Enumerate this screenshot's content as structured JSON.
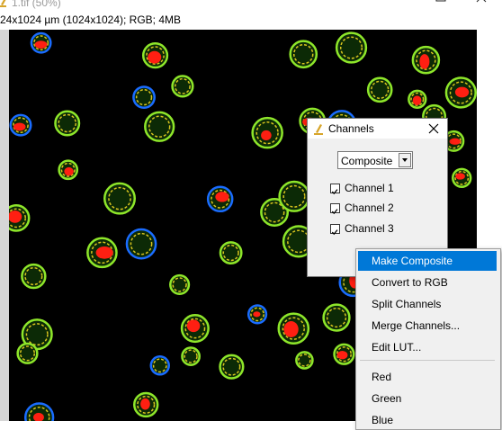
{
  "window": {
    "title": "1.tif (50%)",
    "info": "24x1024 µm (1024x1024); RGB; 4MB"
  },
  "channels_dialog": {
    "title": "Channels",
    "mode_select": "Composite",
    "channels": [
      {
        "label": "Channel 1",
        "checked": true
      },
      {
        "label": "Channel 2",
        "checked": true
      },
      {
        "label": "Channel 3",
        "checked": true
      }
    ]
  },
  "menu": {
    "selected": "Make Composite",
    "items": [
      "Make Composite",
      "Convert to RGB",
      "Split Channels",
      "Merge Channels...",
      "Edit LUT..."
    ],
    "color_items": [
      "Red",
      "Green",
      "Blue"
    ]
  },
  "colors": {
    "selection": "#0078d7",
    "cell_green": "#8ee62a",
    "cell_red": "#ff1f12",
    "cell_yellow": "#d8c41e",
    "cell_blue": "#1a6cff"
  }
}
